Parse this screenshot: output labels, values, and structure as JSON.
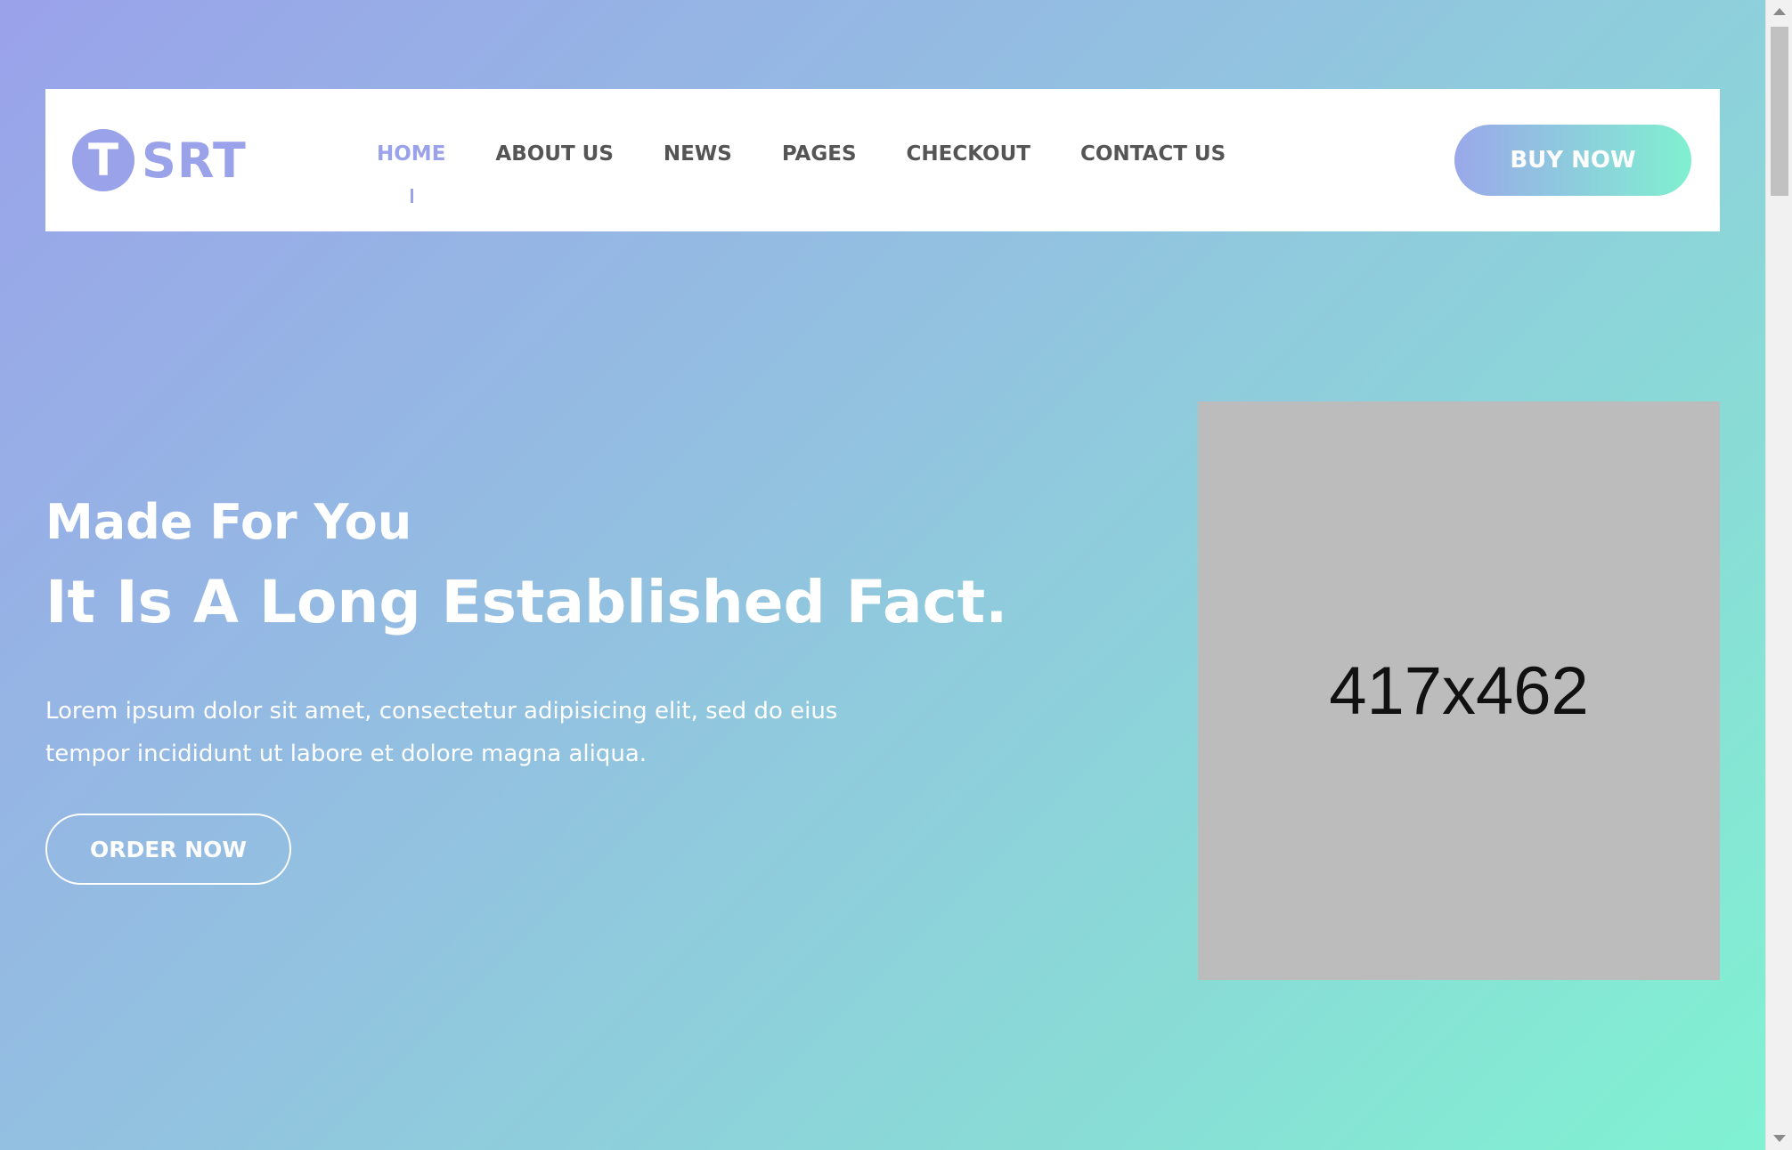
{
  "header": {
    "logo_letter": "T",
    "logo_text": "SRT",
    "nav": {
      "items": [
        {
          "label": "HOME",
          "active": true
        },
        {
          "label": "ABOUT US",
          "active": false
        },
        {
          "label": "NEWS",
          "active": false
        },
        {
          "label": "PAGES",
          "active": false
        },
        {
          "label": "CHECKOUT",
          "active": false
        },
        {
          "label": "CONTACT US",
          "active": false
        }
      ]
    },
    "buy_label": "BUY NOW"
  },
  "hero": {
    "subtitle": "Made For You",
    "title": "It Is A Long Established Fact.",
    "text_line1": "Lorem ipsum dolor sit amet, consectetur adipisicing elit, sed do eius",
    "text_line2": "tempor incididunt ut labore et dolore magna aliqua.",
    "order_label": "ORDER NOW",
    "image_placeholder": "417x462"
  },
  "colors": {
    "accent": "#9aa2ea",
    "gradient_start": "#9aa2ea",
    "gradient_end": "#80f2d2",
    "nav_text": "#555555"
  }
}
